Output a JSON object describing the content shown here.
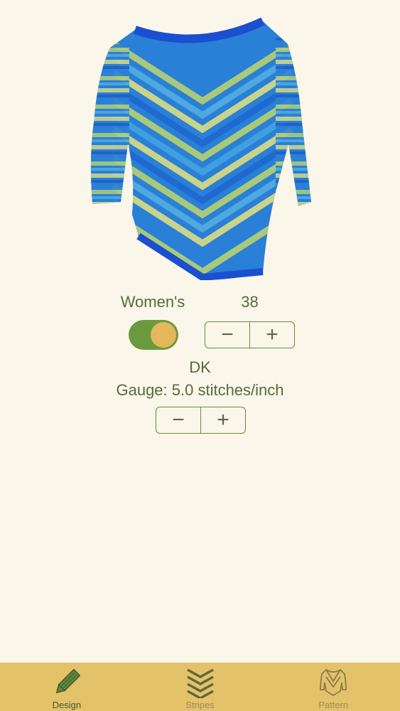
{
  "product_image": {
    "description_icon": "sweater-image"
  },
  "size": {
    "gender_label": "Women's",
    "size_value": "38",
    "toggle_on": true,
    "minus": "−",
    "plus": "+"
  },
  "yarn": {
    "weight_label": "DK",
    "gauge_label": "Gauge: 5.0 stitches/inch",
    "minus": "−",
    "plus": "+"
  },
  "tabs": [
    {
      "label": "Design",
      "icon": "pencil-icon",
      "active": true
    },
    {
      "label": "Stripes",
      "icon": "chevrons-down-icon",
      "active": false
    },
    {
      "label": "Pattern",
      "icon": "sweater-outline-icon",
      "active": false
    }
  ],
  "colors": {
    "background": "#faf6e9",
    "accent_green": "#6a9a3e",
    "knob": "#e4b75a",
    "tabbar": "#e4c26a",
    "text": "#556b3e"
  }
}
